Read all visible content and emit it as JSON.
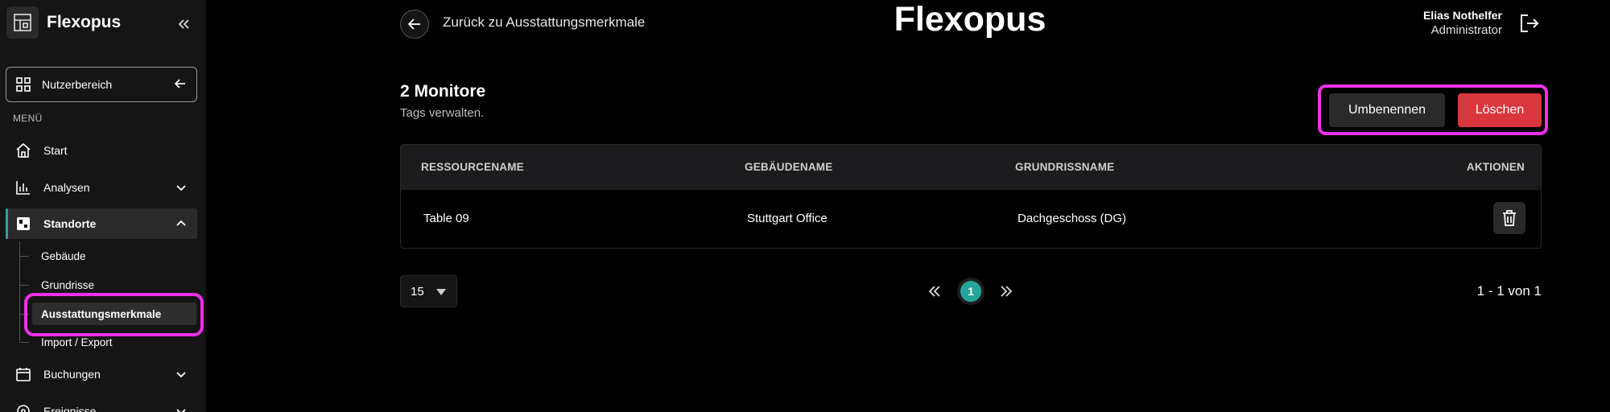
{
  "app": {
    "name": "Flexopus"
  },
  "sidebar": {
    "user_area_label": "Nutzerbereich",
    "menu_heading": "MENÜ",
    "items": [
      {
        "label": "Start"
      },
      {
        "label": "Analysen"
      },
      {
        "label": "Standorte"
      },
      {
        "label": "Buchungen"
      },
      {
        "label": "Ereignisse"
      }
    ],
    "sub_items": [
      {
        "label": "Gebäude"
      },
      {
        "label": "Grundrisse"
      },
      {
        "label": "Ausstattungsmerkmale"
      },
      {
        "label": "Import / Export"
      }
    ]
  },
  "header": {
    "back_label": "Zurück zu Ausstattungsmerkmale",
    "brand": "Flexopus",
    "user_name": "Elias Nothelfer",
    "user_role": "Administrator"
  },
  "main": {
    "title": "2 Monitore",
    "subtitle": "Tags verwalten.",
    "rename_label": "Umbenennen",
    "delete_label": "Löschen",
    "table": {
      "columns": [
        "RESSOURCENAME",
        "GEBÄUDENAME",
        "GRUNDRISSNAME",
        "AKTIONEN"
      ],
      "rows": [
        {
          "resource": "Table 09",
          "building": "Stuttgart Office",
          "floor": "Dachgeschoss (DG)"
        }
      ]
    },
    "pagination": {
      "page_size": "15",
      "current_page": "1",
      "range": "1 - 1 von 1"
    }
  },
  "colors": {
    "accent": "#26a69a",
    "danger": "#d9363e",
    "highlight": "#ee2fe9",
    "sidebar_bg": "#151515"
  }
}
